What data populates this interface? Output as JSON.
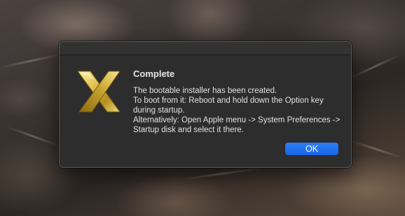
{
  "dialog": {
    "title": "Complete",
    "message": "The bootable installer has been created.\nTo boot from it: Reboot and hold down the Option key during startup.\nAlternatively: Open Apple menu -> System Preferences -> Startup disk and select it there.",
    "ok_label": "OK",
    "icon": "gold-x-icon"
  },
  "colors": {
    "accent": "#1f6ff0",
    "dialog_background": "#2e2d2d",
    "icon_gold": "#d4b84a"
  }
}
